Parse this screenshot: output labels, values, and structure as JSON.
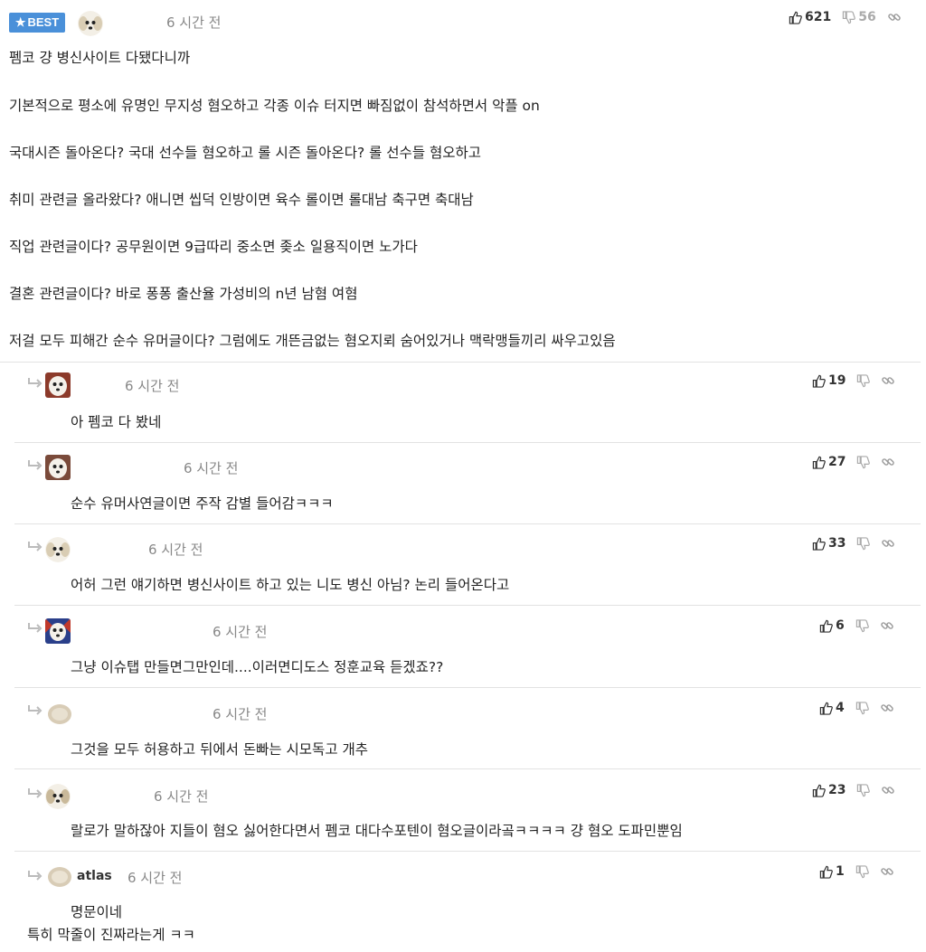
{
  "post": {
    "badge": "BEST",
    "time": "6 시간 전",
    "upvotes": "621",
    "downvotes": "56",
    "lines": [
      "펨코 걍 병신사이트 다됐다니까",
      "기본적으로 평소에 유명인 무지성 혐오하고 각종 이슈 터지면 빠짐없이 참석하면서 악플 on",
      "국대시즌 돌아온다? 국대 선수들 혐오하고 롤 시즌 돌아온다? 롤 선수들 혐오하고",
      "취미 관련글 올라왔다? 애니면 씹덕 인방이면 육수 롤이면 롤대남 축구면 축대남",
      "직업 관련글이다? 공무원이면 9급따리 중소면 좆소 일용직이면 노가다",
      "결혼 관련글이다? 바로 퐁퐁 출산율 가성비의 n년 남혐 여혐",
      "저걸 모두 피해간 순수 유머글이다? 그럼에도 개뜬금없는 혐오지뢰 숨어있거나 맥락맹들끼리 싸우고있음"
    ]
  },
  "replies": [
    {
      "time": "6 시간 전",
      "upvotes": "19",
      "lines": [
        "아 펨코 다 봤네"
      ]
    },
    {
      "time": "6 시간 전",
      "upvotes": "27",
      "lines": [
        "순수 유머사연글이면 주작 감별 들어감ㅋㅋㅋ"
      ]
    },
    {
      "time": "6 시간 전",
      "upvotes": "33",
      "lines": [
        "어허 그런 얘기하면 병신사이트 하고 있는 니도 병신 아님? 논리 들어온다고"
      ]
    },
    {
      "time": "6 시간 전",
      "upvotes": "6",
      "lines": [
        "그냥 이슈탭 만들면그만인데....이러면디도스 정훈교육 듣겠죠??"
      ]
    },
    {
      "time": "6 시간 전",
      "upvotes": "4",
      "lines": [
        "그것을 모두 허용하고 뒤에서 돈빠는 시모독고 개추"
      ]
    },
    {
      "time": "6 시간 전",
      "upvotes": "23",
      "lines": [
        "랄로가 말하잖아 지들이 혐오 싫어한다면서 펨코 대다수포텐이 혐오글이라곸ㅋㅋㅋㅋ 걍 혐오 도파민뿐임"
      ]
    },
    {
      "author": "atlas",
      "time": "6 시간 전",
      "upvotes": "1",
      "lines": [
        "명문이네",
        "특히 막줄이 진짜라는게 ㅋㅋ"
      ]
    }
  ],
  "icons": {
    "badge": "star-icon",
    "upvote": "thumbs-up-icon",
    "downvote": "thumbs-down-icon",
    "link": "link-icon",
    "reply": "reply-arrow-icon"
  },
  "colors": {
    "badge": "#4a90d9",
    "meta": "#888888",
    "divider": "#e2e2e2"
  }
}
